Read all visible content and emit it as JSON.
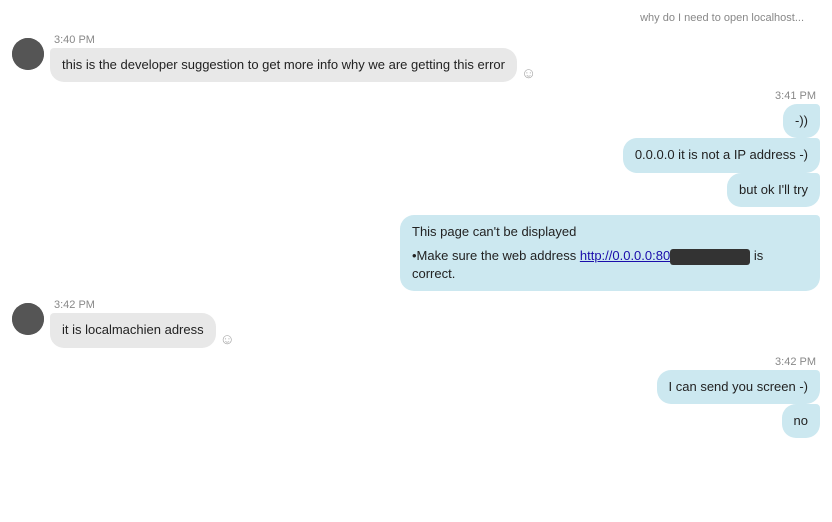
{
  "chat": {
    "messages": [
      {
        "id": "msg-partial-top",
        "type": "outgoing-partial",
        "text": "why do I need to open localhost..."
      },
      {
        "id": "msg1",
        "type": "incoming",
        "timestamp": "3:40 PM",
        "text": "this is the developer suggestion to get more info why we are getting this error",
        "has_emoji": true,
        "emoji": "☺"
      },
      {
        "id": "msg2",
        "type": "outgoing-group",
        "timestamp": "3:41 PM",
        "bubbles": [
          {
            "text": "-))"
          },
          {
            "text": "0.0.0.0 it is not a IP address -)"
          },
          {
            "text": "but ok I'll try"
          }
        ]
      },
      {
        "id": "msg3",
        "type": "outgoing-screenshot",
        "text_line1": "This page can't be displayed",
        "text_line2": "•Make sure the web address ",
        "link": "http://0.0.0.0:80",
        "text_line3": " is correct."
      },
      {
        "id": "msg4",
        "type": "incoming",
        "timestamp": "3:42 PM",
        "text": "it is localmachien adress",
        "has_emoji": true,
        "emoji": "☺"
      },
      {
        "id": "msg5",
        "type": "outgoing-group",
        "timestamp": "3:42 PM",
        "bubbles": [
          {
            "text": "I can send you screen -)"
          },
          {
            "text": "no"
          }
        ]
      }
    ]
  }
}
